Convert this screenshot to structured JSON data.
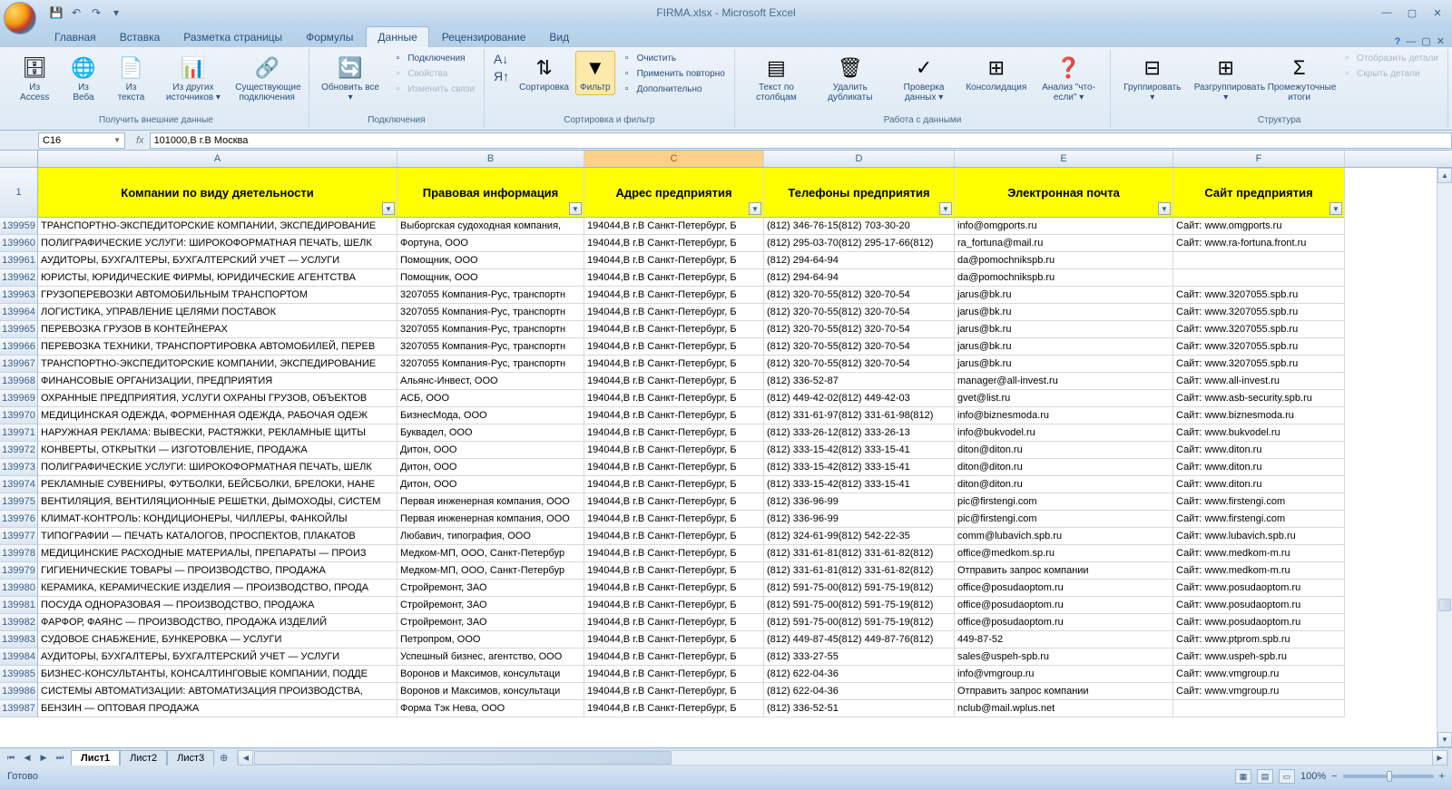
{
  "app": {
    "title": "FIRMA.xlsx - Microsoft Excel"
  },
  "qat": {
    "save": "💾",
    "undo": "↶",
    "redo": "↷"
  },
  "tabs": [
    "Главная",
    "Вставка",
    "Разметка страницы",
    "Формулы",
    "Данные",
    "Рецензирование",
    "Вид"
  ],
  "activeTab": 4,
  "ribbon": {
    "g1": {
      "label": "Получить внешние данные",
      "btns": [
        {
          "ico": "🗄",
          "lbl": "Из Access"
        },
        {
          "ico": "🌐",
          "lbl": "Из Веба"
        },
        {
          "ico": "📄",
          "lbl": "Из текста"
        },
        {
          "ico": "📊",
          "lbl": "Из других источников ▾"
        },
        {
          "ico": "🔗",
          "lbl": "Существующие подключения"
        }
      ]
    },
    "g2": {
      "label": "Подключения",
      "btn": {
        "ico": "🔄",
        "lbl": "Обновить все ▾"
      },
      "items": [
        "Подключения",
        "Свойства",
        "Изменить связи"
      ]
    },
    "g3": {
      "label": "Сортировка и фильтр",
      "sortAZ": "А↓",
      "sortZA": "Я↑",
      "sortBtn": {
        "ico": "⇅",
        "lbl": "Сортировка"
      },
      "filterBtn": {
        "ico": "▼",
        "lbl": "Фильтр"
      },
      "items": [
        "Очистить",
        "Применить повторно",
        "Дополнительно"
      ]
    },
    "g4": {
      "label": "Работа с данными",
      "btns": [
        {
          "ico": "▤",
          "lbl": "Текст по столбцам"
        },
        {
          "ico": "🗑",
          "lbl": "Удалить дубликаты"
        },
        {
          "ico": "✓",
          "lbl": "Проверка данных ▾"
        },
        {
          "ico": "⊞",
          "lbl": "Консолидация"
        },
        {
          "ico": "❓",
          "lbl": "Анализ \"что-если\" ▾"
        }
      ]
    },
    "g5": {
      "label": "Структура",
      "btns": [
        {
          "ico": "⊟",
          "lbl": "Группировать ▾"
        },
        {
          "ico": "⊞",
          "lbl": "Разгруппировать ▾"
        },
        {
          "ico": "Σ",
          "lbl": "Промежуточные итоги"
        }
      ],
      "items": [
        "Отобразить детали",
        "Скрыть детали"
      ]
    }
  },
  "nameBox": "C16",
  "formula": "101000,В г.В Москва",
  "columns": [
    "A",
    "B",
    "C",
    "D",
    "E",
    "F"
  ],
  "selectedCol": 2,
  "headers": [
    "Компании по виду дяетельности",
    "Правовая информация",
    "Адрес предприятия",
    "Телефоны предприятия",
    "Электронная почта",
    "Сайт предприятия"
  ],
  "headerRowNum": "1",
  "rows": [
    {
      "n": "139959",
      "c": [
        "ТРАНСПОРТНО-ЭКСПЕДИТОРСКИЕ КОМПАНИИ, ЭКСПЕДИРОВАНИЕ",
        "Выборгская судоходная компания,",
        "194044,В г.В Санкт-Петербург, Б",
        "(812) 346-76-15(812) 703-30-20",
        "info@omgports.ru",
        "Сайт: www.omgports.ru"
      ]
    },
    {
      "n": "139960",
      "c": [
        "ПОЛИГРАФИЧЕСКИЕ УСЛУГИ: ШИРОКОФОРМАТНАЯ ПЕЧАТЬ, ШЕЛК",
        "Фортуна, ООО",
        "194044,В г.В Санкт-Петербург, Б",
        "(812) 295-03-70(812) 295-17-66(812)",
        "ra_fortuna@mail.ru",
        "Сайт: www.ra-fortuna.front.ru"
      ]
    },
    {
      "n": "139961",
      "c": [
        "АУДИТОРЫ, БУХГАЛТЕРЫ, БУХГАЛТЕРСКИЙ УЧЕТ — УСЛУГИ",
        "Помощник, ООО",
        "194044,В г.В Санкт-Петербург, Б",
        "(812) 294-64-94",
        "da@pomochnikspb.ru",
        ""
      ]
    },
    {
      "n": "139962",
      "c": [
        "ЮРИСТЫ, ЮРИДИЧЕСКИЕ ФИРМЫ, ЮРИДИЧЕСКИЕ АГЕНТСТВА",
        "Помощник, ООО",
        "194044,В г.В Санкт-Петербург, Б",
        "(812) 294-64-94",
        "da@pomochnikspb.ru",
        ""
      ]
    },
    {
      "n": "139963",
      "c": [
        "ГРУЗОПЕРЕВОЗКИ АВТОМОБИЛЬНЫМ ТРАНСПОРТОМ",
        "3207055 Компания-Рус, транспортн",
        "194044,В г.В Санкт-Петербург, Б",
        "(812) 320-70-55(812) 320-70-54",
        "jarus@bk.ru",
        "Сайт: www.3207055.spb.ru"
      ]
    },
    {
      "n": "139964",
      "c": [
        "ЛОГИСТИКА, УПРАВЛЕНИЕ ЦЕЛЯМИ ПОСТАВОК",
        "3207055 Компания-Рус, транспортн",
        "194044,В г.В Санкт-Петербург, Б",
        "(812) 320-70-55(812) 320-70-54",
        "jarus@bk.ru",
        "Сайт: www.3207055.spb.ru"
      ]
    },
    {
      "n": "139965",
      "c": [
        "ПЕРЕВОЗКА ГРУЗОВ В КОНТЕЙНЕРАХ",
        "3207055 Компания-Рус, транспортн",
        "194044,В г.В Санкт-Петербург, Б",
        "(812) 320-70-55(812) 320-70-54",
        "jarus@bk.ru",
        "Сайт: www.3207055.spb.ru"
      ]
    },
    {
      "n": "139966",
      "c": [
        "ПЕРЕВОЗКА ТЕХНИКИ, ТРАНСПОРТИРОВКА АВТОМОБИЛЕЙ, ПЕРЕВ",
        "3207055 Компания-Рус, транспортн",
        "194044,В г.В Санкт-Петербург, Б",
        "(812) 320-70-55(812) 320-70-54",
        "jarus@bk.ru",
        "Сайт: www.3207055.spb.ru"
      ]
    },
    {
      "n": "139967",
      "c": [
        "ТРАНСПОРТНО-ЭКСПЕДИТОРСКИЕ КОМПАНИИ, ЭКСПЕДИРОВАНИЕ",
        "3207055 Компания-Рус, транспортн",
        "194044,В г.В Санкт-Петербург, Б",
        "(812) 320-70-55(812) 320-70-54",
        "jarus@bk.ru",
        "Сайт: www.3207055.spb.ru"
      ]
    },
    {
      "n": "139968",
      "c": [
        "ФИНАНСОВЫЕ ОРГАНИЗАЦИИ, ПРЕДПРИЯТИЯ",
        "Альянс-Инвест, ООО",
        "194044,В г.В Санкт-Петербург, Б",
        "(812) 336-52-87",
        "manager@all-invest.ru",
        "Сайт: www.all-invest.ru"
      ]
    },
    {
      "n": "139969",
      "c": [
        "ОХРАННЫЕ ПРЕДПРИЯТИЯ, УСЛУГИ ОХРАНЫ ГРУЗОВ, ОБЪЕКТОВ",
        "АСБ, ООО",
        "194044,В г.В Санкт-Петербург, Б",
        "(812) 449-42-02(812) 449-42-03",
        "gvet@list.ru",
        "Сайт: www.asb-security.spb.ru"
      ]
    },
    {
      "n": "139970",
      "c": [
        "МЕДИЦИНСКАЯ ОДЕЖДА, ФОРМЕННАЯ ОДЕЖДА, РАБОЧАЯ ОДЕЖ",
        "БизнесМода, ООО",
        "194044,В г.В Санкт-Петербург, Б",
        "(812) 331-61-97(812) 331-61-98(812)",
        "info@biznesmoda.ru",
        "Сайт: www.biznesmoda.ru"
      ]
    },
    {
      "n": "139971",
      "c": [
        "НАРУЖНАЯ РЕКЛАМА: ВЫВЕСКИ, РАСТЯЖКИ, РЕКЛАМНЫЕ ЩИТЫ",
        "Буквадел, ООО",
        "194044,В г.В Санкт-Петербург, Б",
        "(812) 333-26-12(812) 333-26-13",
        "info@bukvodel.ru",
        "Сайт: www.bukvodel.ru"
      ]
    },
    {
      "n": "139972",
      "c": [
        "КОНВЕРТЫ, ОТКРЫТКИ — ИЗГОТОВЛЕНИЕ, ПРОДАЖА",
        "Дитон, ООО",
        "194044,В г.В Санкт-Петербург, Б",
        "(812) 333-15-42(812) 333-15-41",
        "diton@diton.ru",
        "Сайт: www.diton.ru"
      ]
    },
    {
      "n": "139973",
      "c": [
        "ПОЛИГРАФИЧЕСКИЕ УСЛУГИ: ШИРОКОФОРМАТНАЯ ПЕЧАТЬ, ШЕЛК",
        "Дитон, ООО",
        "194044,В г.В Санкт-Петербург, Б",
        "(812) 333-15-42(812) 333-15-41",
        "diton@diton.ru",
        "Сайт: www.diton.ru"
      ]
    },
    {
      "n": "139974",
      "c": [
        "РЕКЛАМНЫЕ СУВЕНИРЫ, ФУТБОЛКИ, БЕЙСБОЛКИ, БРЕЛОКИ, НАНЕ",
        "Дитон, ООО",
        "194044,В г.В Санкт-Петербург, Б",
        "(812) 333-15-42(812) 333-15-41",
        "diton@diton.ru",
        "Сайт: www.diton.ru"
      ]
    },
    {
      "n": "139975",
      "c": [
        "ВЕНТИЛЯЦИЯ, ВЕНТИЛЯЦИОННЫЕ РЕШЕТКИ, ДЫМОХОДЫ, СИСТЕМ",
        "Первая инженерная компания, ООО",
        "194044,В г.В Санкт-Петербург, Б",
        "(812) 336-96-99",
        "pic@firstengi.com",
        "Сайт: www.firstengi.com"
      ]
    },
    {
      "n": "139976",
      "c": [
        "КЛИМАТ-КОНТРОЛЬ: КОНДИЦИОНЕРЫ, ЧИЛЛЕРЫ, ФАНКОЙЛЫ",
        "Первая инженерная компания, ООО",
        "194044,В г.В Санкт-Петербург, Б",
        "(812) 336-96-99",
        "pic@firstengi.com",
        "Сайт: www.firstengi.com"
      ]
    },
    {
      "n": "139977",
      "c": [
        "ТИПОГРАФИИ — ПЕЧАТЬ КАТАЛОГОВ, ПРОСПЕКТОВ, ПЛАКАТОВ",
        "Любавич, типография, ООО",
        "194044,В г.В Санкт-Петербург, Б",
        "(812) 324-61-99(812) 542-22-35",
        "comm@lubavich.spb.ru",
        "Сайт: www.lubavich.spb.ru"
      ]
    },
    {
      "n": "139978",
      "c": [
        "МЕДИЦИНСКИЕ РАСХОДНЫЕ МАТЕРИАЛЫ, ПРЕПАРАТЫ — ПРОИЗ",
        "Медком-МП, ООО, Санкт-Петербур",
        "194044,В г.В Санкт-Петербург, Б",
        "(812) 331-61-81(812) 331-61-82(812)",
        "office@medkom.sp.ru",
        "Сайт: www.medkom-m.ru"
      ]
    },
    {
      "n": "139979",
      "c": [
        "ГИГИЕНИЧЕСКИЕ ТОВАРЫ — ПРОИЗВОДСТВО, ПРОДАЖА",
        "Медком-МП, ООО, Санкт-Петербур",
        "194044,В г.В Санкт-Петербург, Б",
        "(812) 331-61-81(812) 331-61-82(812)",
        "Отправить запрос компании",
        "Сайт: www.medkom-m.ru"
      ]
    },
    {
      "n": "139980",
      "c": [
        "КЕРАМИКА, КЕРАМИЧЕСКИЕ ИЗДЕЛИЯ — ПРОИЗВОДСТВО, ПРОДА",
        "Стройремонт, ЗАО",
        "194044,В г.В Санкт-Петербург, Б",
        "(812) 591-75-00(812) 591-75-19(812)",
        "office@posudaoptom.ru",
        "Сайт: www.posudaoptom.ru"
      ]
    },
    {
      "n": "139981",
      "c": [
        "ПОСУДА ОДНОРАЗОВАЯ — ПРОИЗВОДСТВО, ПРОДАЖА",
        "Стройремонт, ЗАО",
        "194044,В г.В Санкт-Петербург, Б",
        "(812) 591-75-00(812) 591-75-19(812)",
        "office@posudaoptom.ru",
        "Сайт: www.posudaoptom.ru"
      ]
    },
    {
      "n": "139982",
      "c": [
        "ФАРФОР, ФАЯНС — ПРОИЗВОДСТВО, ПРОДАЖА ИЗДЕЛИЙ",
        "Стройремонт, ЗАО",
        "194044,В г.В Санкт-Петербург, Б",
        "(812) 591-75-00(812) 591-75-19(812)",
        "office@posudaoptom.ru",
        "Сайт: www.posudaoptom.ru"
      ]
    },
    {
      "n": "139983",
      "c": [
        "СУДОВОЕ СНАБЖЕНИЕ, БУНКЕРОВКА — УСЛУГИ",
        "Петропром, ООО",
        "194044,В г.В Санкт-Петербург, Б",
        "(812) 449-87-45(812) 449-87-76(812)",
        "449-87-52",
        "Сайт: www.ptprom.spb.ru"
      ]
    },
    {
      "n": "139984",
      "c": [
        "АУДИТОРЫ, БУХГАЛТЕРЫ, БУХГАЛТЕРСКИЙ УЧЕТ — УСЛУГИ",
        "Успешный бизнес, агентство, ООО",
        "194044,В г.В Санкт-Петербург, Б",
        "(812) 333-27-55",
        "sales@uspeh-spb.ru",
        "Сайт: www.uspeh-spb.ru"
      ]
    },
    {
      "n": "139985",
      "c": [
        "БИЗНЕС-КОНСУЛЬТАНТЫ, КОНСАЛТИНГОВЫЕ КОМПАНИИ, ПОДДЕ",
        "Воронов и Максимов, консультаци",
        "194044,В г.В Санкт-Петербург, Б",
        "(812) 622-04-36",
        "info@vmgroup.ru",
        "Сайт: www.vmgroup.ru"
      ]
    },
    {
      "n": "139986",
      "c": [
        "СИСТЕМЫ АВТОМАТИЗАЦИИ: АВТОМАТИЗАЦИЯ ПРОИЗВОДСТВА,",
        "Воронов и Максимов, консультаци",
        "194044,В г.В Санкт-Петербург, Б",
        "(812) 622-04-36",
        "Отправить запрос компании",
        "Сайт: www.vmgroup.ru"
      ]
    },
    {
      "n": "139987",
      "c": [
        "БЕНЗИН — ОПТОВАЯ ПРОДАЖА",
        "Форма Тэк Нева, ООО",
        "194044,В г.В Санкт-Петербург, Б",
        "(812) 336-52-51",
        "nclub@mail.wplus.net",
        ""
      ]
    }
  ],
  "sheets": [
    "Лист1",
    "Лист2",
    "Лист3"
  ],
  "activeSheet": 0,
  "status": {
    "ready": "Готово",
    "zoom": "100%"
  }
}
